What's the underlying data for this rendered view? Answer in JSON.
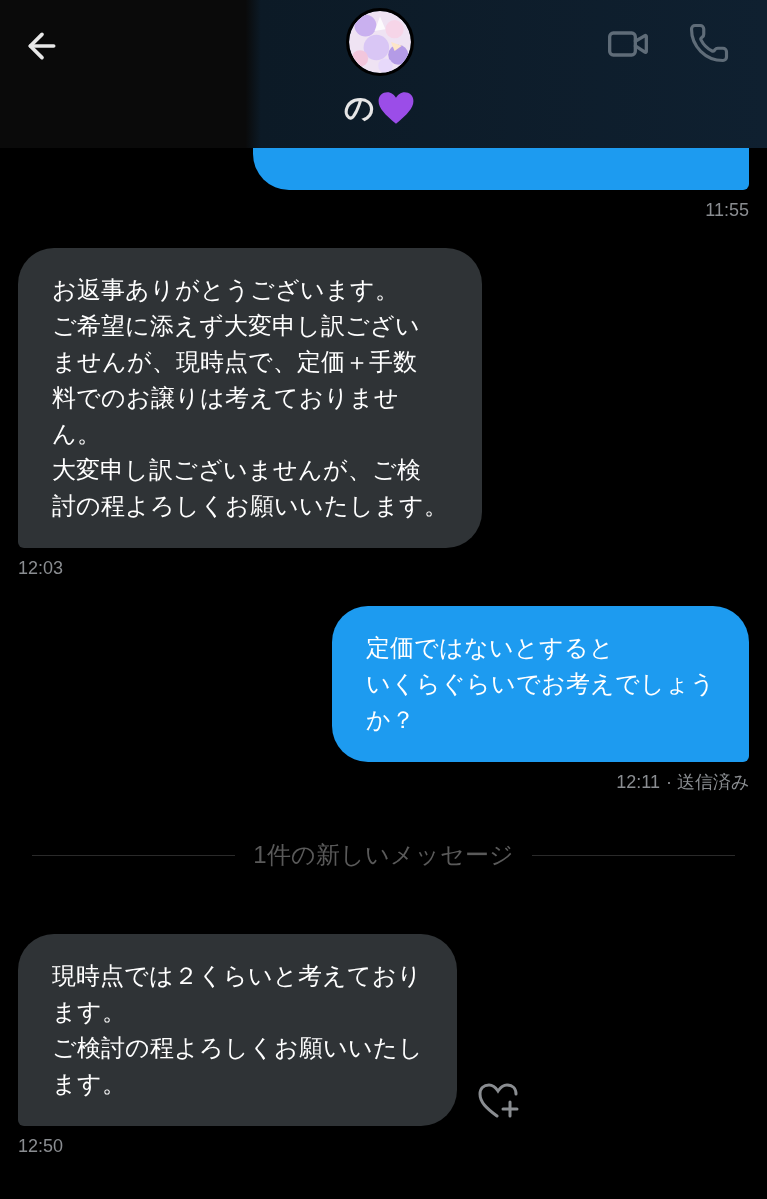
{
  "header": {
    "name": "の"
  },
  "messages": [
    {
      "kind": "sent",
      "time": "11:55"
    },
    {
      "kind": "received",
      "lines": [
        "お返事ありがとうございます。",
        "ご希望に添えず大変申し訳ござい",
        "ませんが、現時点で、定価＋手数",
        "料でのお譲りは考えておりませ",
        "ん。",
        "大変申し訳ございませんが、ご検",
        "討の程よろしくお願いいたします。"
      ],
      "time": "12:03"
    },
    {
      "kind": "sent",
      "lines": [
        "定価ではないとすると",
        "いくらぐらいでお考えでしょう",
        "か？"
      ],
      "time": "12:11",
      "status": "· 送信済み"
    },
    {
      "kind": "divider",
      "text": "1件の新しいメッセージ"
    },
    {
      "kind": "received",
      "lines": [
        "現時点では２くらいと考えており",
        "ます。",
        "ご検討の程よろしくお願いいたし",
        "ます。"
      ],
      "time": "12:50",
      "reaction_prompt": true
    }
  ]
}
